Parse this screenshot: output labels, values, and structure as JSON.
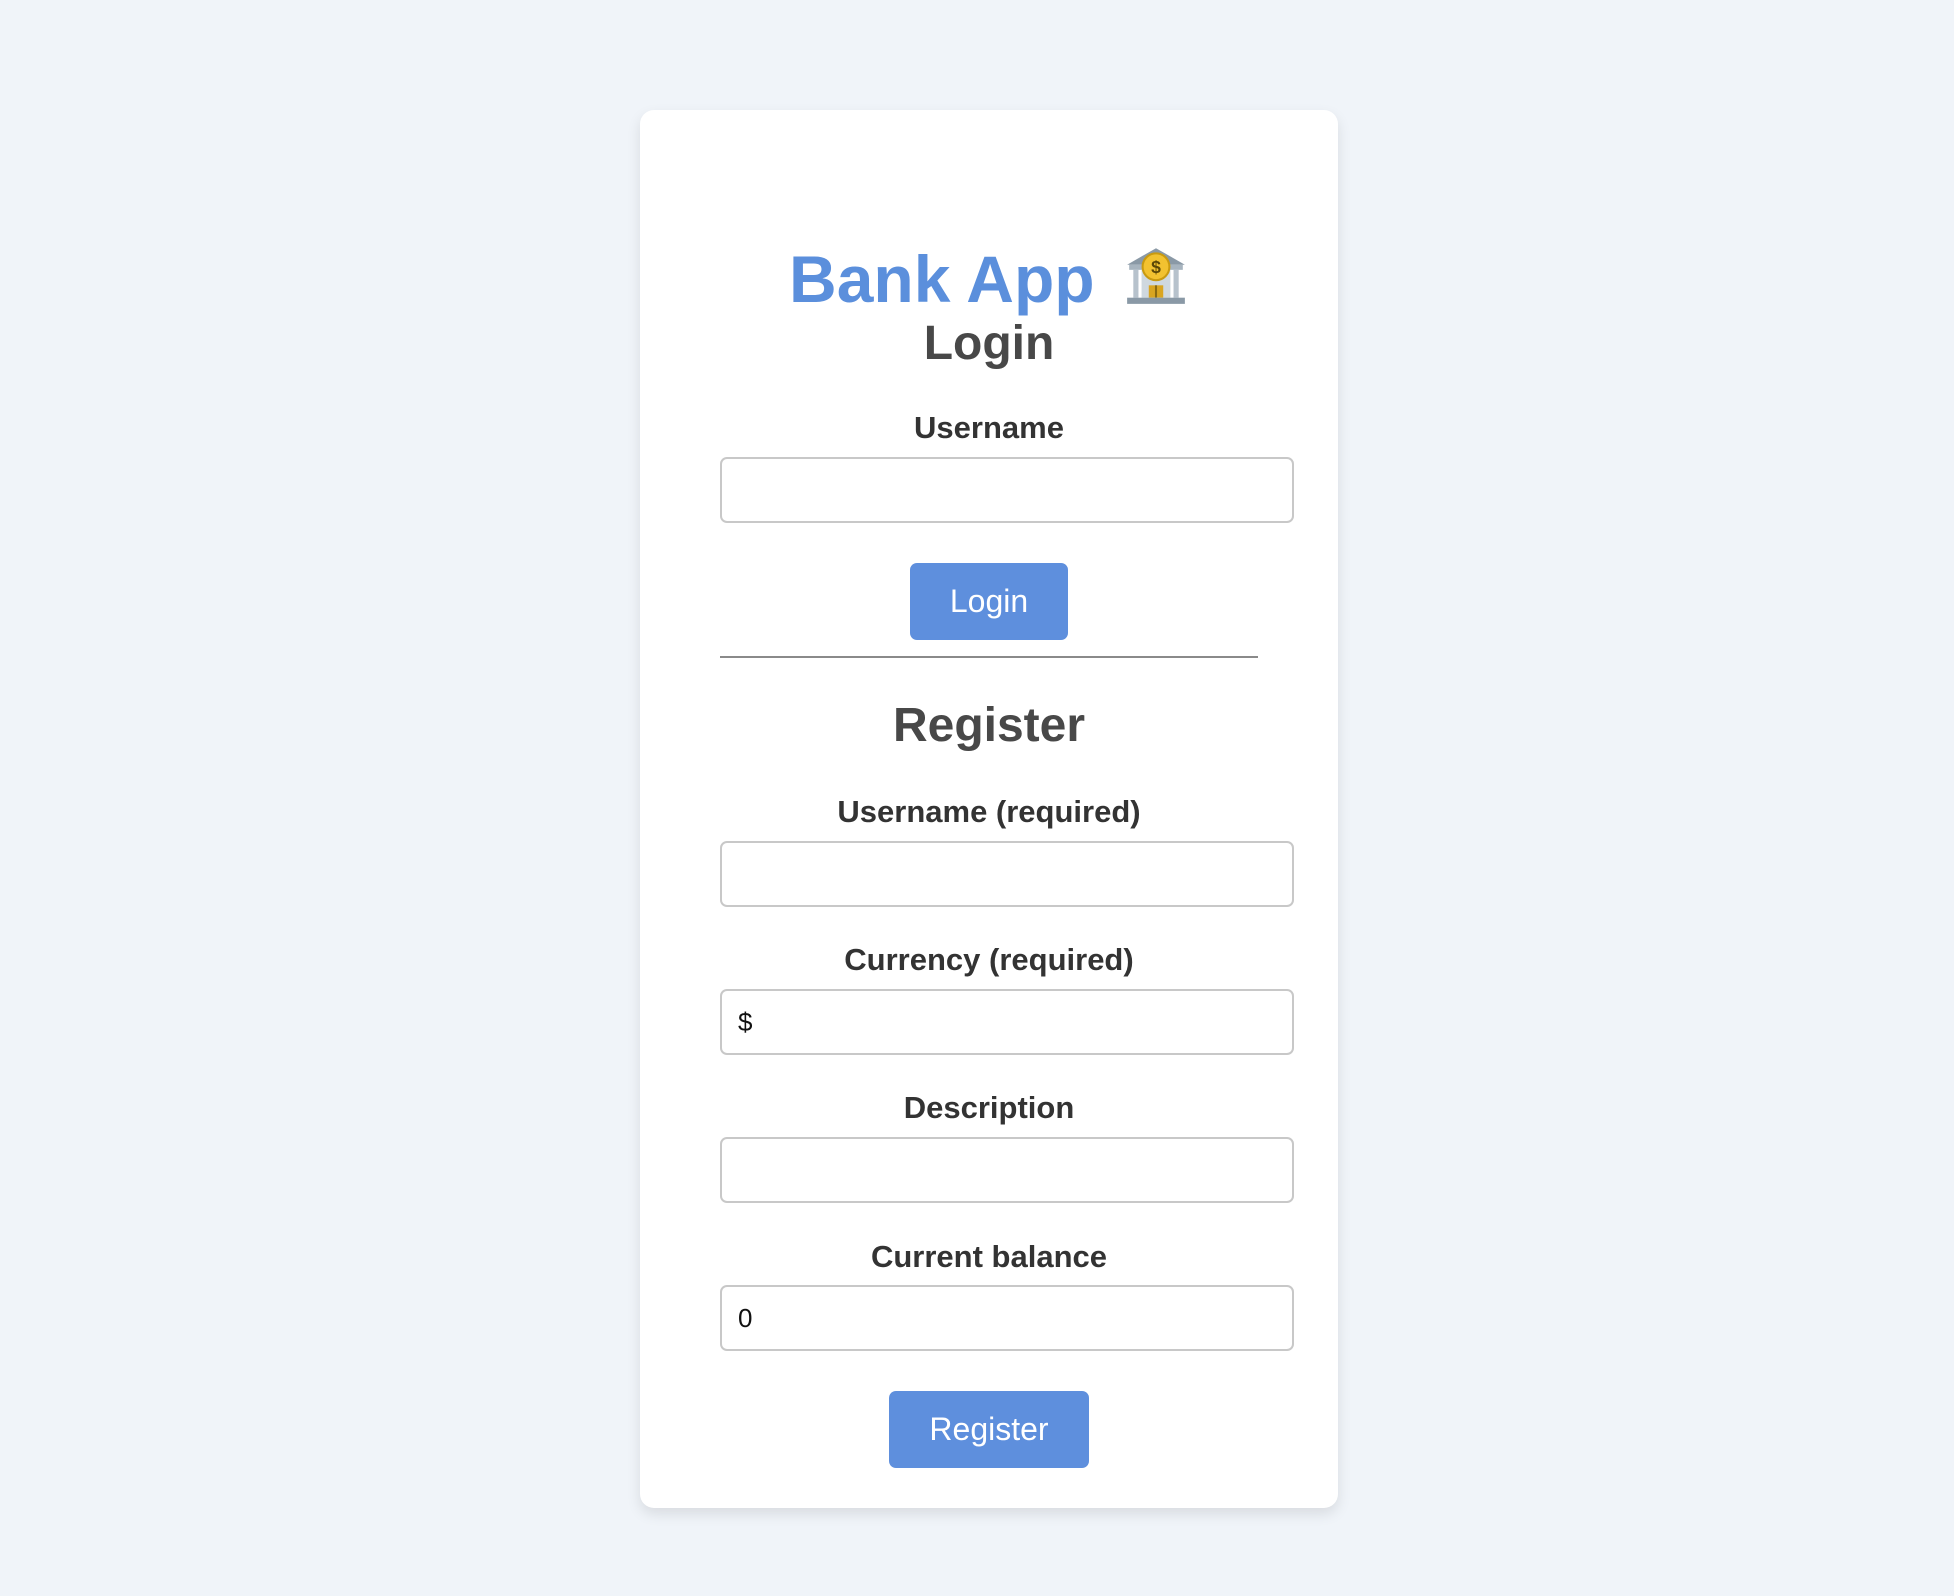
{
  "app": {
    "title": "Bank App",
    "title_icon": "bank-icon",
    "accent_color": "#5b8fdc",
    "background_color": "#f0f4f9"
  },
  "login": {
    "heading": "Login",
    "username_label": "Username",
    "username_value": "",
    "submit_label": "Login"
  },
  "register": {
    "heading": "Register",
    "username_label": "Username (required)",
    "username_value": "",
    "currency_label": "Currency (required)",
    "currency_value": "$",
    "description_label": "Description",
    "description_value": "",
    "balance_label": "Current balance",
    "balance_value": "0",
    "submit_label": "Register"
  }
}
